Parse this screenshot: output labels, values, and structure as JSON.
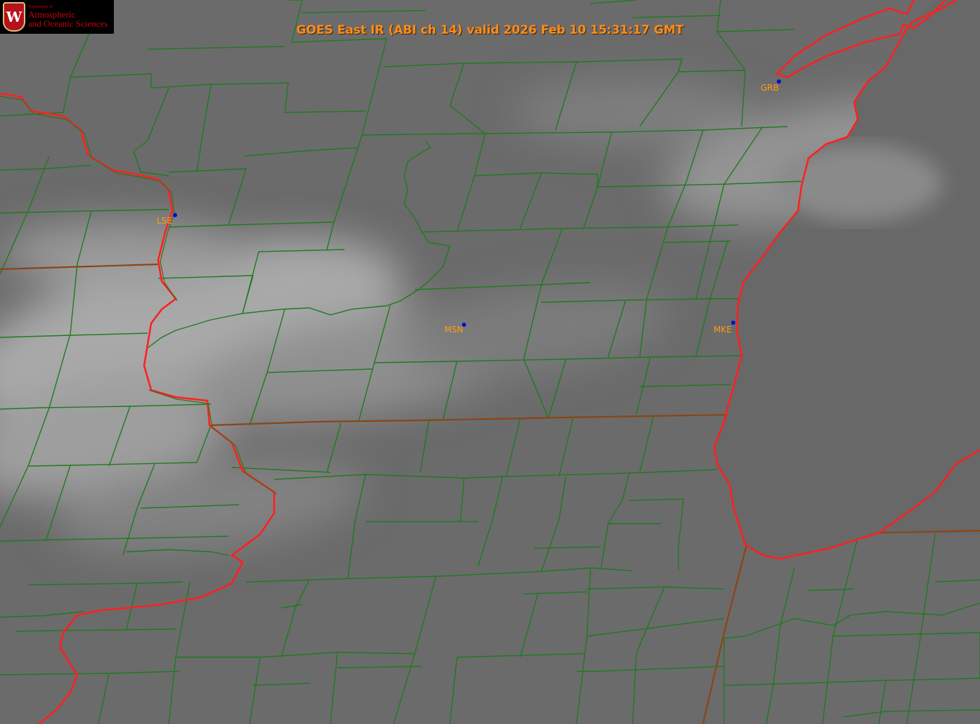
{
  "title": "GOES East IR (ABI ch 14) valid 2026 Feb 10 15:31:17 GMT",
  "logo": {
    "dept": "Department of",
    "line1": "Atmospheric",
    "line2": "and Oceanic Sciences",
    "crest_letter": "W"
  },
  "cities": [
    {
      "code": "GRB"
    },
    {
      "code": "LSE"
    },
    {
      "code": "MSN"
    },
    {
      "code": "MKE"
    }
  ],
  "colors": {
    "county_lines": "#1f7a1f",
    "state_lines": "#8b4513",
    "coastline": "#ff2020",
    "city_dot": "#0010d0",
    "city_label": "#ff9a1a",
    "title": "#ff8c1a",
    "background": "#6e6e6e",
    "lake": "#6a6a6a"
  }
}
